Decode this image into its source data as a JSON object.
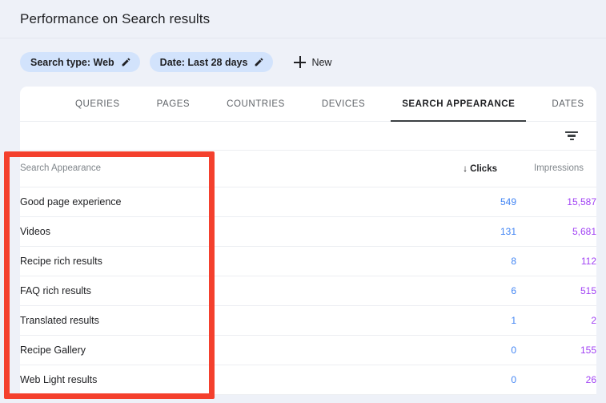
{
  "header": {
    "title": "Performance on Search results"
  },
  "filters": {
    "chips": [
      {
        "label": "Search type: Web",
        "edit_icon": "pencil-icon"
      },
      {
        "label": "Date: Last 28 days",
        "edit_icon": "pencil-icon"
      }
    ],
    "new_button": {
      "label": "New",
      "icon": "plus-icon"
    }
  },
  "tabs": [
    {
      "label": "QUERIES",
      "active": false
    },
    {
      "label": "PAGES",
      "active": false
    },
    {
      "label": "COUNTRIES",
      "active": false
    },
    {
      "label": "DEVICES",
      "active": false
    },
    {
      "label": "SEARCH APPEARANCE",
      "active": true
    },
    {
      "label": "DATES",
      "active": false
    }
  ],
  "toolbar": {
    "filter_icon": "filter-funnel-icon"
  },
  "table": {
    "columns": {
      "name": "Search Appearance",
      "clicks": "Clicks",
      "impressions": "Impressions"
    },
    "sort": {
      "column": "Clicks",
      "direction": "descending",
      "arrow": "↓"
    },
    "rows": [
      {
        "name": "Good page experience",
        "clicks": "549",
        "impressions": "15,587"
      },
      {
        "name": "Videos",
        "clicks": "131",
        "impressions": "5,681"
      },
      {
        "name": "Recipe rich results",
        "clicks": "8",
        "impressions": "112"
      },
      {
        "name": "FAQ rich results",
        "clicks": "6",
        "impressions": "515"
      },
      {
        "name": "Translated results",
        "clicks": "1",
        "impressions": "2"
      },
      {
        "name": "Recipe Gallery",
        "clicks": "0",
        "impressions": "155"
      },
      {
        "name": "Web Light results",
        "clicks": "0",
        "impressions": "26"
      }
    ]
  },
  "annotation": {
    "highlight_color": "#f4402d",
    "target": "Search Appearance column"
  },
  "colors": {
    "clicks": "#4285f4",
    "impressions": "#a142f4",
    "chip_background": "#d2e3fc",
    "page_background": "#eef1f8"
  }
}
